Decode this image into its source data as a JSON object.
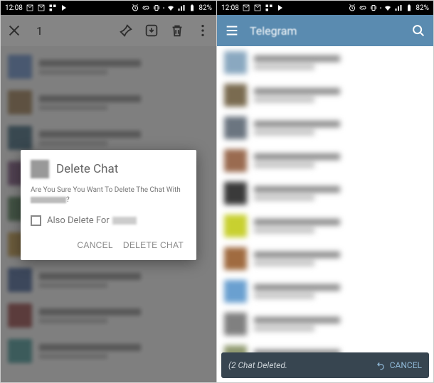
{
  "status": {
    "time": "12:08",
    "battery": "82%"
  },
  "left": {
    "action_bar": {
      "count": "1"
    },
    "dialog": {
      "title": "Delete Chat",
      "message_prefix": "Are You Sure You Want To Delete The Chat With",
      "message_suffix": "?",
      "checkbox_label_prefix": "Also Delete For",
      "cancel": "CANCEL",
      "confirm": "DELETE CHAT"
    }
  },
  "right": {
    "header": {
      "title": "Telegram"
    },
    "snackbar": {
      "message": "(2 Chat Deleted.",
      "action": "CANCEL"
    }
  },
  "chat_placeholders": [
    {
      "avatar": "#7b9ac9"
    },
    {
      "avatar": "#a58c6b"
    },
    {
      "avatar": "#5b7a8a"
    },
    {
      "avatar": "#8a6b8c"
    },
    {
      "avatar": "#6b8c6f"
    },
    {
      "avatar": "#c0a060"
    },
    {
      "avatar": "#6077a0"
    },
    {
      "avatar": "#a06060"
    },
    {
      "avatar": "#60a0a0"
    }
  ],
  "tg_chats": [
    {
      "c": "#8aa8c0"
    },
    {
      "c": "#7a6b50"
    },
    {
      "c": "#6b7580"
    },
    {
      "c": "#9a6b50"
    },
    {
      "c": "#3a3a3a"
    },
    {
      "c": "#c8d030"
    },
    {
      "c": "#a06b40"
    },
    {
      "c": "#6aa0d0"
    },
    {
      "c": "#808080"
    },
    {
      "c": "#909a70"
    }
  ]
}
